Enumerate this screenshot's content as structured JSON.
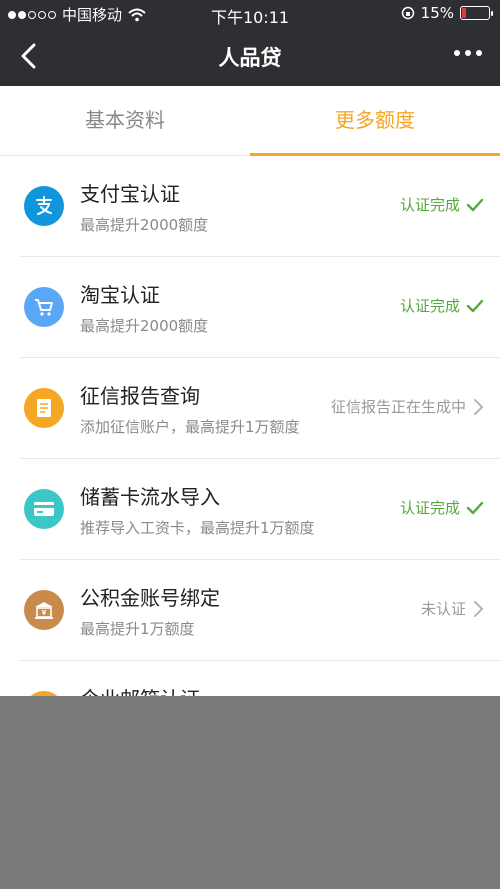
{
  "status_bar": {
    "carrier": "中国移动",
    "time": "下午10:11",
    "battery": "15%"
  },
  "nav": {
    "title": "人品贷"
  },
  "tabs": [
    {
      "label": "基本资料",
      "active": false
    },
    {
      "label": "更多额度",
      "active": true
    }
  ],
  "items": [
    {
      "title": "支付宝认证",
      "subtitle": "最高提升2000额度",
      "status": "认证完成",
      "icon": "alipay-icon",
      "icon_color": "#1296db"
    },
    {
      "title": "淘宝认证",
      "subtitle": "最高提升2000额度",
      "status": "认证完成",
      "icon": "cart-icon",
      "icon_color": "#5aa6f7"
    },
    {
      "title": "征信报告查询",
      "subtitle": "添加征信账户，最高提升1万额度",
      "status": "征信报告正在生成中",
      "icon": "report-icon",
      "icon_color": "#f5a623"
    },
    {
      "title": "储蓄卡流水导入",
      "subtitle": "推荐导入工资卡，最高提升1万额度",
      "status": "认证完成",
      "icon": "card-icon",
      "icon_color": "#3cc6c6"
    },
    {
      "title": "公积金账号绑定",
      "subtitle": "最高提升1万额度",
      "status": "未认证",
      "icon": "fund-icon",
      "icon_color": "#c98a4b"
    },
    {
      "title": "企业邮箱认证",
      "icon": "mail-icon",
      "icon_color": "#f5a623"
    }
  ],
  "colors": {
    "bar_bg": "#2e2f33",
    "accent": "#f5a623",
    "done": "#56a83d"
  }
}
